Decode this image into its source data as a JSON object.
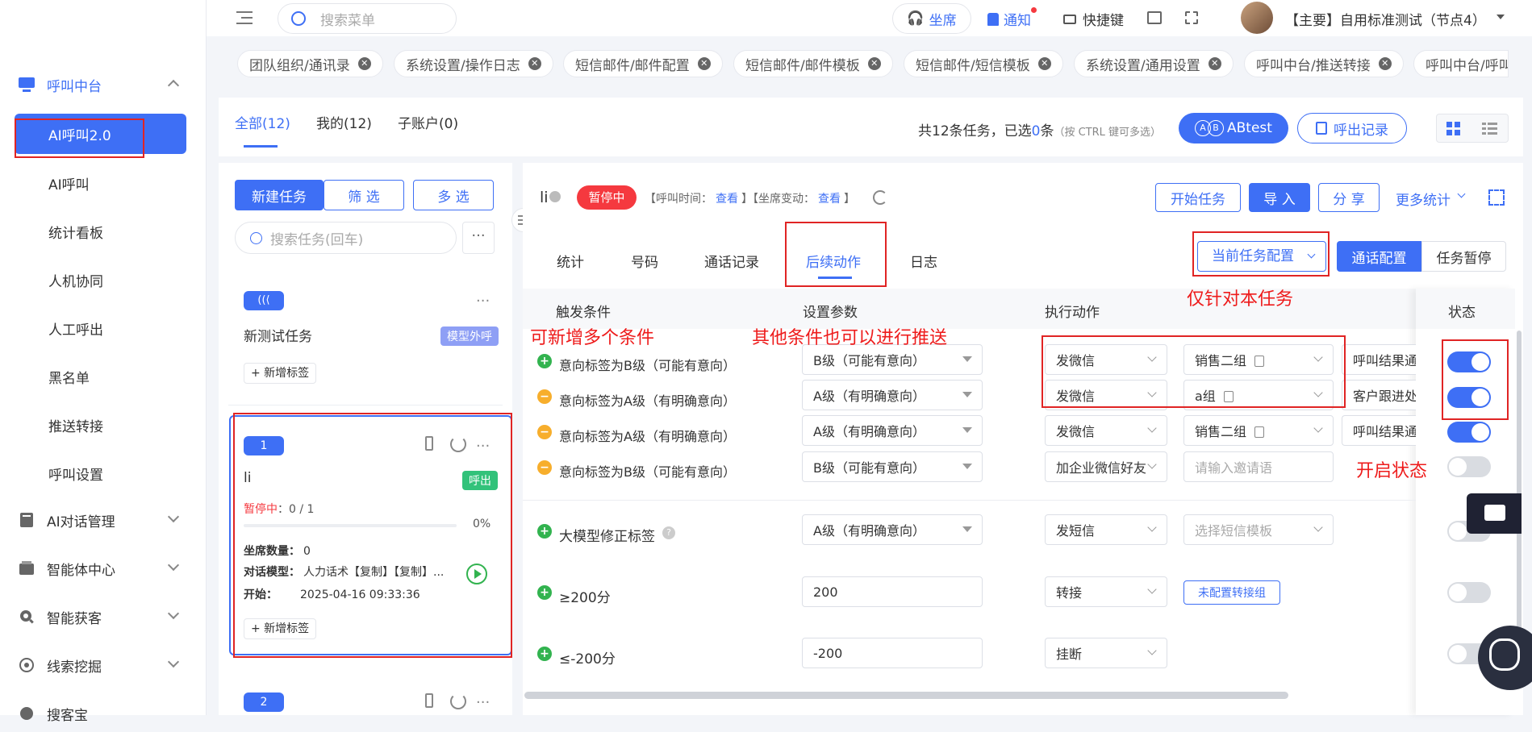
{
  "sidebar": {
    "menu": [
      {
        "label": "呼叫中台",
        "icon": "monitor-icon",
        "active": true
      },
      {
        "label": "AI对话管理",
        "icon": "book-icon"
      },
      {
        "label": "智能体中心",
        "icon": "agent-icon"
      },
      {
        "label": "智能获客",
        "icon": "search-person-icon"
      },
      {
        "label": "线索挖掘",
        "icon": "target-icon"
      },
      {
        "label": "搜客宝",
        "icon": "search-icon"
      }
    ],
    "sub_items": [
      "AI呼叫2.0",
      "AI呼叫",
      "统计看板",
      "人机协同",
      "人工呼出",
      "黑名单",
      "推送转接",
      "呼叫设置"
    ]
  },
  "topbar": {
    "search_placeholder": "搜索菜单",
    "seat": "坐席",
    "notify": "通知",
    "shortcut": "快捷键",
    "account": "【主要】自用标准测试（节点4）"
  },
  "open_tabs": [
    "团队组织/通讯录",
    "系统设置/操作日志",
    "短信邮件/邮件配置",
    "短信邮件/邮件模板",
    "短信邮件/短信模板",
    "系统设置/通用设置",
    "呼叫中台/推送转接",
    "呼叫中台/呼叫"
  ],
  "task_tabs": [
    {
      "label": "全部(12)",
      "active": true
    },
    {
      "label": "我的(12)"
    },
    {
      "label": "子账户(0)"
    }
  ],
  "summary": {
    "prefix": "共12条任务，已选",
    "count": "0",
    "suffix": "条",
    "hint": "（按 CTRL 键可多选）",
    "abtest": "ABtest",
    "call_records": "呼出记录"
  },
  "left_panel": {
    "new_task": "新建任务",
    "filter": "筛 选",
    "multi": "多 选",
    "search_placeholder": "搜索任务(回车)",
    "tasks": [
      {
        "name": "新测试任务",
        "badge": "模型外呼",
        "add_tag": "+ 新增标签"
      },
      {
        "index": "1",
        "name": "li",
        "type_badge": "呼出",
        "status": "暂停中",
        "progress_text": "：0 / 1",
        "percent": "0%",
        "seat_label": "坐席数量：",
        "seat_value": "0",
        "model_label": "对话模型：",
        "model_value": "人力话术【复制】【复制】...",
        "start_label": "开始：",
        "start_value": "2025-04-16 09:33:36",
        "add_tag": "+ 新增标签"
      },
      {
        "index": "2"
      }
    ]
  },
  "detail": {
    "name": "li",
    "status": "暂停中",
    "call_time_label": "【呼叫时间：",
    "call_time_link": "查看",
    "seat_change_label": "】【坐席变动：",
    "seat_change_link": "查看",
    "close_bracket": "】",
    "start_btn": "开始任务",
    "import_btn": "导 入",
    "share_btn": "分 享",
    "more_stats": "更多统计",
    "tabs": [
      "统计",
      "号码",
      "通话记录",
      "后续动作",
      "日志"
    ],
    "active_tab": "后续动作",
    "config_select": "当前任务配置",
    "call_config": "通话配置",
    "task_pause": "任务暂停",
    "columns": [
      "触发条件",
      "设置参数",
      "执行动作",
      "状态"
    ],
    "rows": [
      {
        "cond": "意向标签为B级（可能有意向）",
        "kind": "plus",
        "param": "B级（可能有意向）",
        "action": "发微信",
        "target": "销售二组",
        "extra": "呼叫结果通",
        "on": true
      },
      {
        "cond": "意向标签为A级（有明确意向）",
        "kind": "minus",
        "param": "A级（有明确意向）",
        "action": "发微信",
        "target": "a组",
        "extra": "客户跟进处",
        "on": true
      },
      {
        "cond": "意向标签为A级（有明确意向）",
        "kind": "minus",
        "param": "A级（有明确意向）",
        "action": "发微信",
        "target": "销售二组",
        "extra": "呼叫结果通",
        "on": true
      },
      {
        "cond": "意向标签为B级（可能有意向）",
        "kind": "minus",
        "param": "B级（可能有意向）",
        "action": "加企业微信好友",
        "target_placeholder": "请输入邀请语",
        "on": false
      },
      {
        "cond": "大模型修正标签",
        "kind": "plus",
        "param": "A级（有明确意向）",
        "action": "发短信",
        "target_placeholder": "选择短信模板",
        "on": false
      },
      {
        "cond": "≥200分",
        "kind": "plus",
        "param": "200",
        "action": "转接",
        "target_btn": "未配置转接组",
        "on": false
      },
      {
        "cond": "≤-200分",
        "kind": "plus",
        "param": "-200",
        "action": "挂断",
        "on": false
      }
    ]
  },
  "annotations": [
    "可新增多个条件",
    "其他条件也可以进行推送",
    "仅针对本任务",
    "开启状态"
  ],
  "colors": {
    "primary": "#3e6ff5",
    "danger": "#ee1b1b",
    "pause": "#f5393f"
  }
}
